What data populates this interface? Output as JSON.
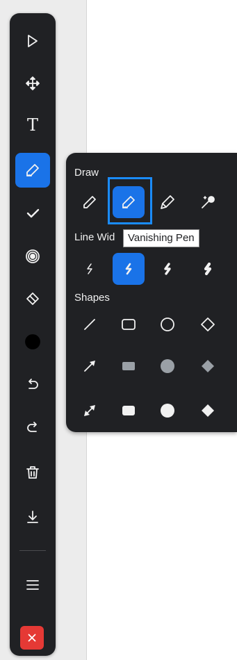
{
  "toolbar": {
    "items": [
      {
        "name": "select",
        "icon": "cursor-arrow-icon"
      },
      {
        "name": "move",
        "icon": "move-arrows-icon"
      },
      {
        "name": "text",
        "icon": "text-icon",
        "glyph": "T"
      },
      {
        "name": "draw",
        "icon": "pen-icon",
        "active": true
      },
      {
        "name": "check",
        "icon": "checkmark-icon"
      },
      {
        "name": "spotlight",
        "icon": "radar-icon"
      },
      {
        "name": "eraser",
        "icon": "eraser-icon"
      },
      {
        "name": "color",
        "icon": "color-dot-icon",
        "color": "#000000"
      },
      {
        "name": "undo",
        "icon": "undo-icon"
      },
      {
        "name": "redo",
        "icon": "redo-icon"
      },
      {
        "name": "delete",
        "icon": "trash-icon"
      },
      {
        "name": "download",
        "icon": "download-icon"
      },
      {
        "name": "menu",
        "icon": "hamburger-menu-icon"
      },
      {
        "name": "close",
        "icon": "close-icon"
      }
    ]
  },
  "panel": {
    "draw_label": "Draw",
    "line_width_label": "Line Wid",
    "shapes_label": "Shapes",
    "draw_tools": [
      "pencil",
      "vanishing-pen",
      "highlighter",
      "magic-wand"
    ],
    "selected_draw_tool": "vanishing-pen",
    "line_widths": [
      "thin",
      "medium",
      "thick",
      "extra-thick"
    ],
    "selected_line_width": "medium"
  },
  "tooltip": {
    "text": "Vanishing Pen"
  },
  "colors": {
    "toolbar_bg": "#202124",
    "accent": "#1a73e8",
    "close": "#e53935",
    "highlight_border": "#1a8cff"
  }
}
